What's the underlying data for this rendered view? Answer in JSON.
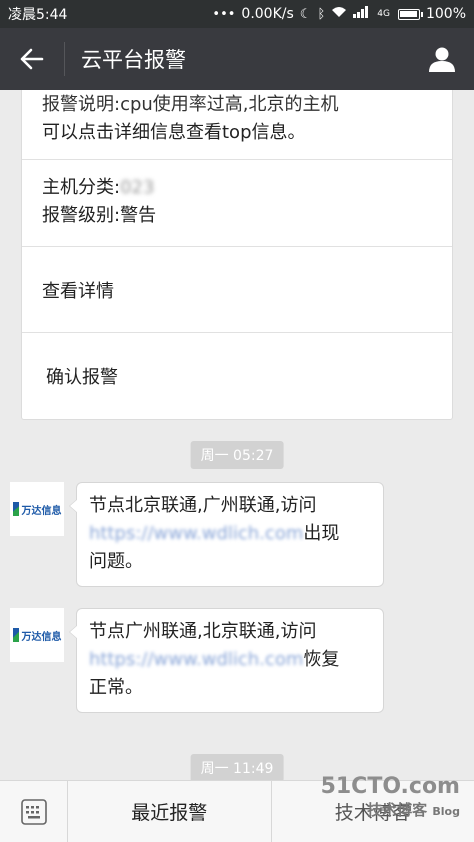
{
  "status_bar": {
    "time": "凌晨5:44",
    "network_speed": "0.00K/s",
    "signal_label": "4G",
    "battery": "100%",
    "battery_level": 1.0
  },
  "header": {
    "title": "云平台报警"
  },
  "alert_card": {
    "description_line1": "报警说明:cpu使用率过高,北京的主机",
    "description_line2": "可以点击详细信息查看top信息。",
    "host_category": "主机分类:",
    "host_category_value": "023",
    "alert_level": "报警级别:警告",
    "view_details": "查看详情",
    "confirm_alert": "确认报警"
  },
  "timestamps": [
    "周一 05:27",
    "周一 11:49"
  ],
  "sender": {
    "name": "万达信息"
  },
  "messages": [
    {
      "line1": "节点北京联通,广州联通,访问",
      "link": "https://www.wdlich.com",
      "after_link": "出现",
      "line3": "问题。"
    },
    {
      "line1": "节点广州联通,北京联通,访问",
      "link": "https://www.wdlich.com",
      "after_link": "恢复",
      "line3": "正常。"
    }
  ],
  "bottom_menu": {
    "recent_alerts": "最近报警",
    "second_item": "技术博客"
  },
  "watermark": {
    "line1": "51CTO.com",
    "line2": "技术博客",
    "line3": "Blog"
  }
}
